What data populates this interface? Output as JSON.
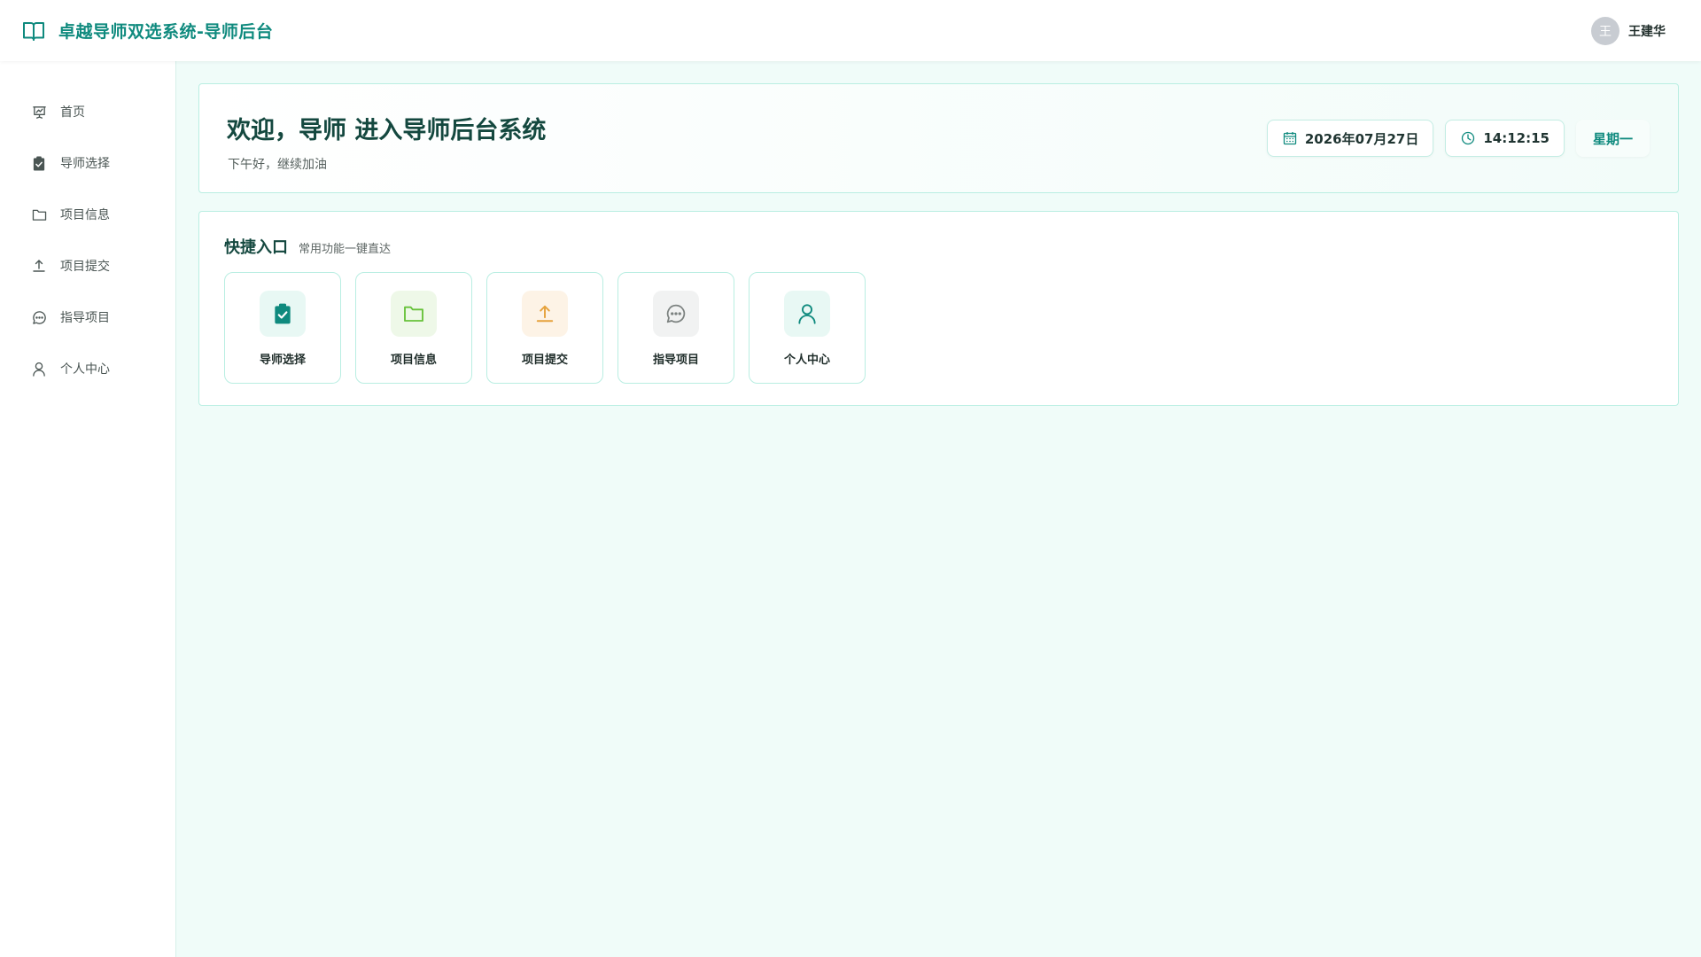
{
  "app": {
    "title": "卓越导师双选系统-导师后台"
  },
  "user": {
    "avatar_initial": "王",
    "name": "王建华"
  },
  "sidebar": {
    "items": [
      {
        "label": "首页",
        "icon": "presentation-chart-icon"
      },
      {
        "label": "导师选择",
        "icon": "clipboard-check-icon"
      },
      {
        "label": "项目信息",
        "icon": "folder-icon"
      },
      {
        "label": "项目提交",
        "icon": "upload-icon"
      },
      {
        "label": "指导项目",
        "icon": "chat-bubble-icon"
      },
      {
        "label": "个人中心",
        "icon": "user-icon"
      }
    ]
  },
  "welcome": {
    "title": "欢迎，导师 进入导师后台系统",
    "subtitle": "下午好，继续加油",
    "date": "2026年07月27日",
    "time": "14:12:15",
    "weekday": "星期一"
  },
  "quick": {
    "title": "快捷入口",
    "subtitle": "常用功能一键直达",
    "cards": [
      {
        "label": "导师选择",
        "icon": "clipboard-check-icon",
        "color": "#0f8a7e",
        "bg": "#e8f8f4"
      },
      {
        "label": "项目信息",
        "icon": "folder-icon",
        "color": "#67c23a",
        "bg": "#eef8e8"
      },
      {
        "label": "项目提交",
        "icon": "upload-icon",
        "color": "#e6a23c",
        "bg": "#fdf3e6"
      },
      {
        "label": "指导项目",
        "icon": "chat-bubble-icon",
        "color": "#7c8280",
        "bg": "#f1f2f2"
      },
      {
        "label": "个人中心",
        "icon": "user-icon",
        "color": "#0f8a7e",
        "bg": "#e8f8f4"
      }
    ]
  },
  "colors": {
    "accent": "#0f8a7e",
    "border": "#b9eee2",
    "background": "#f0fcf9"
  }
}
